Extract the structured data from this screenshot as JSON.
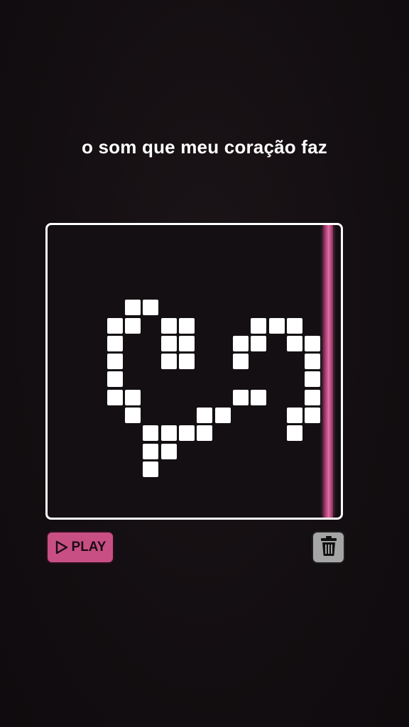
{
  "page": {
    "title": "o som que meu coração faz"
  },
  "grid": {
    "cell_color": "#ffffff",
    "board_border_color": "#ffffff",
    "playhead_color": "#d05a90",
    "active_cells": [
      [
        2,
        4
      ],
      [
        3,
        4
      ],
      [
        1,
        5
      ],
      [
        2,
        5
      ],
      [
        4,
        5
      ],
      [
        5,
        5
      ],
      [
        1,
        6
      ],
      [
        4,
        6
      ],
      [
        5,
        6
      ],
      [
        1,
        7
      ],
      [
        4,
        7
      ],
      [
        5,
        7
      ],
      [
        1,
        8
      ],
      [
        1,
        9
      ],
      [
        2,
        9
      ],
      [
        2,
        10
      ],
      [
        3,
        11
      ],
      [
        4,
        11
      ],
      [
        5,
        11
      ],
      [
        3,
        12
      ],
      [
        4,
        12
      ],
      [
        3,
        13
      ],
      [
        6,
        10
      ],
      [
        7,
        10
      ],
      [
        6,
        11
      ],
      [
        8,
        9
      ],
      [
        9,
        9
      ],
      [
        9,
        5
      ],
      [
        10,
        5
      ],
      [
        11,
        5
      ],
      [
        8,
        6
      ],
      [
        9,
        6
      ],
      [
        11,
        6
      ],
      [
        12,
        6
      ],
      [
        8,
        7
      ],
      [
        12,
        7
      ],
      [
        12,
        8
      ],
      [
        12,
        9
      ],
      [
        11,
        10
      ],
      [
        12,
        10
      ],
      [
        11,
        11
      ]
    ]
  },
  "controls": {
    "play_label": "PLAY",
    "play_color": "#c84f84",
    "play_icon": "play-outline-icon",
    "delete_icon": "trash-icon",
    "delete_color": "#a5a5a5"
  }
}
